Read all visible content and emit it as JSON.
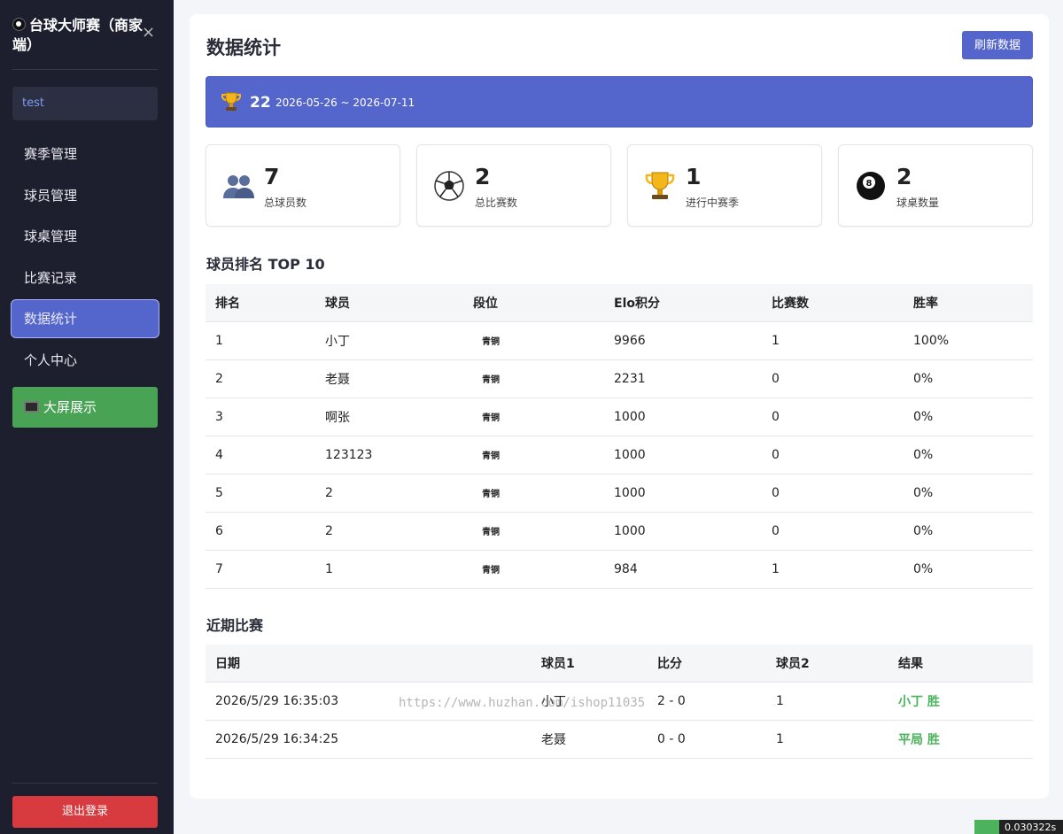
{
  "sidebar": {
    "title": "台球大师赛（商家端）",
    "close_label": "×",
    "username": "test",
    "items": [
      {
        "label": "赛季管理"
      },
      {
        "label": "球员管理"
      },
      {
        "label": "球桌管理"
      },
      {
        "label": "比赛记录"
      },
      {
        "label": "数据统计",
        "active": true
      },
      {
        "label": "个人中心"
      }
    ],
    "big_screen_label": "大屏展示",
    "logout_label": "退出登录"
  },
  "main": {
    "title": "数据统计",
    "refresh_label": "刷新数据",
    "season": {
      "number": "22",
      "range": "2026-05-26 ~ 2026-07-11"
    },
    "stats": [
      {
        "icon": "players-icon",
        "value": "7",
        "label": "总球员数"
      },
      {
        "icon": "soccer-ball-icon",
        "value": "2",
        "label": "总比赛数"
      },
      {
        "icon": "trophy-icon",
        "value": "1",
        "label": "进行中赛季"
      },
      {
        "icon": "eight-ball-icon",
        "value": "2",
        "label": "球桌数量"
      }
    ],
    "ranking": {
      "title": "球员排名 TOP 10",
      "columns": [
        "排名",
        "球员",
        "段位",
        "Elo积分",
        "比赛数",
        "胜率"
      ],
      "rows": [
        [
          "1",
          "小丁",
          "青铜",
          "9966",
          "1",
          "100%"
        ],
        [
          "2",
          "老聂",
          "青铜",
          "2231",
          "0",
          "0%"
        ],
        [
          "3",
          "啊张",
          "青铜",
          "1000",
          "0",
          "0%"
        ],
        [
          "4",
          "123123",
          "青铜",
          "1000",
          "0",
          "0%"
        ],
        [
          "5",
          "2",
          "青铜",
          "1000",
          "0",
          "0%"
        ],
        [
          "6",
          "2",
          "青铜",
          "1000",
          "0",
          "0%"
        ],
        [
          "7",
          "1",
          "青铜",
          "984",
          "1",
          "0%"
        ]
      ]
    },
    "recent": {
      "title": "近期比赛",
      "columns": [
        "日期",
        "球员1",
        "比分",
        "球员2",
        "结果"
      ],
      "rows": [
        [
          "2026/5/29 16:35:03",
          "小丁",
          "2 - 0",
          "1",
          "小丁 胜"
        ],
        [
          "2026/5/29 16:34:25",
          "老聂",
          "0 - 0",
          "1",
          "平局 胜"
        ]
      ]
    }
  },
  "watermark": "https://www.huzhan.com/ishop11035",
  "corner_badge": "0.030322s",
  "colors": {
    "accent": "#5465cc",
    "sidebar": "#1d1e2e",
    "success": "#49a355",
    "danger": "#d73a3f",
    "win_text": "#4cb35c"
  }
}
